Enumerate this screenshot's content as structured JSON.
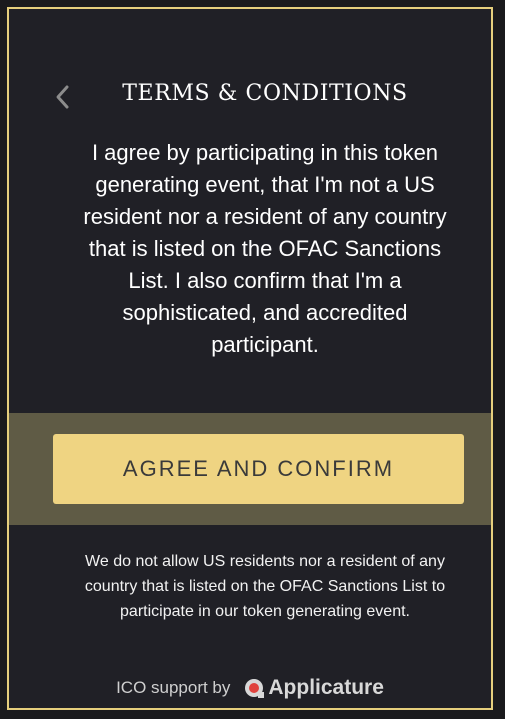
{
  "modal": {
    "title": "TERMS & CONDITIONS",
    "back_icon": "chevron-left-icon",
    "body": "I agree by participating in this token generating event, that I'm not a US resident nor a resident of any country that is listed on the OFAC Sanctions List. I also confirm that I'm a sophisticated, and accredited participant.",
    "agree_button": "AGREE AND CONFIRM",
    "notice": "We do not allow US residents nor a resident of any country that is listed on the OFAC Sanctions List to participate in our token generating event.",
    "support_text": "ICO support by",
    "brand_icon": "applicature-logo-icon",
    "brand_name": "Applicature"
  },
  "colors": {
    "page_bg": "#1a1a1d",
    "panel_bg": "#202026",
    "border": "#e6cf7d",
    "band": "#5f5b45",
    "button": "#efd482",
    "brand_accent": "#e0433e"
  }
}
